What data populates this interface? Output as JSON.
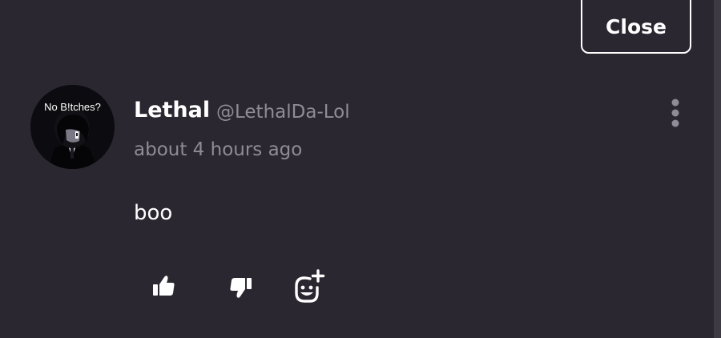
{
  "header": {
    "close_label": "Close"
  },
  "comment": {
    "avatar_caption": "No B!tches?",
    "author_name": "Lethal",
    "author_handle": "@LethalDa-Lol",
    "timestamp": "about 4 hours ago",
    "body": "boo"
  },
  "actions": {
    "like_icon": "thumbs-up-icon",
    "dislike_icon": "thumbs-down-icon",
    "react_icon": "add-reaction-icon",
    "more_icon": "kebab-menu-icon"
  },
  "colors": {
    "background": "#2a2731",
    "primary_text": "#ffffff",
    "secondary_text": "#8f8b97",
    "menu_dots": "#8f8b97"
  }
}
